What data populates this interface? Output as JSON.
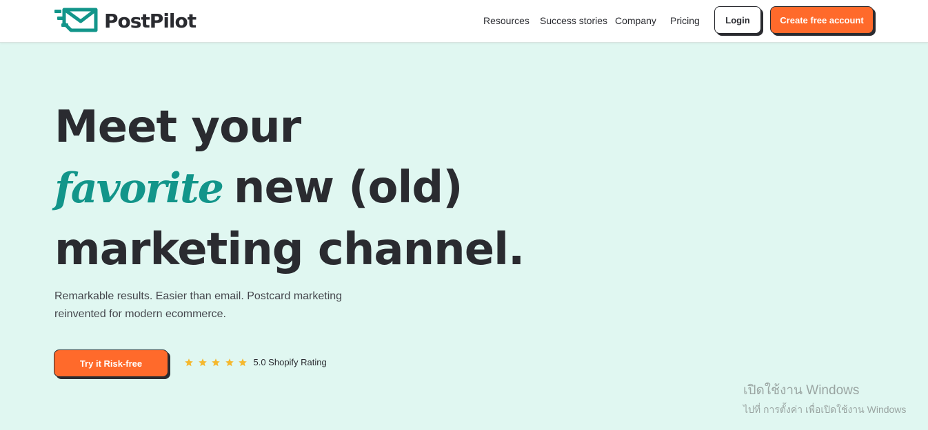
{
  "brand": {
    "name": "PostPilot",
    "accent_color": "#ff6a2b",
    "teal_color": "#12958a",
    "background_color": "#e0f7f1"
  },
  "nav": {
    "links": [
      "Resources",
      "Success stories",
      "Company",
      "Pricing"
    ],
    "login_label": "Login",
    "create_account_label": "Create free account"
  },
  "hero": {
    "line1": "Meet your",
    "line2_script": "favorite",
    "line2_rest": "new (old)",
    "line3": "marketing channel.",
    "subtitle": "Remarkable results. Easier than email. Postcard marketing reinvented for modern ecommerce.",
    "cta_label": "Try it Risk-free",
    "rating": {
      "stars": 5,
      "star_icon": "star-icon",
      "text": "5.0 Shopify Rating"
    }
  },
  "watermark": {
    "title": "เปิดใช้งาน Windows",
    "subtitle": "ไปที่ การตั้งค่า เพื่อเปิดใช้งาน Windows"
  }
}
